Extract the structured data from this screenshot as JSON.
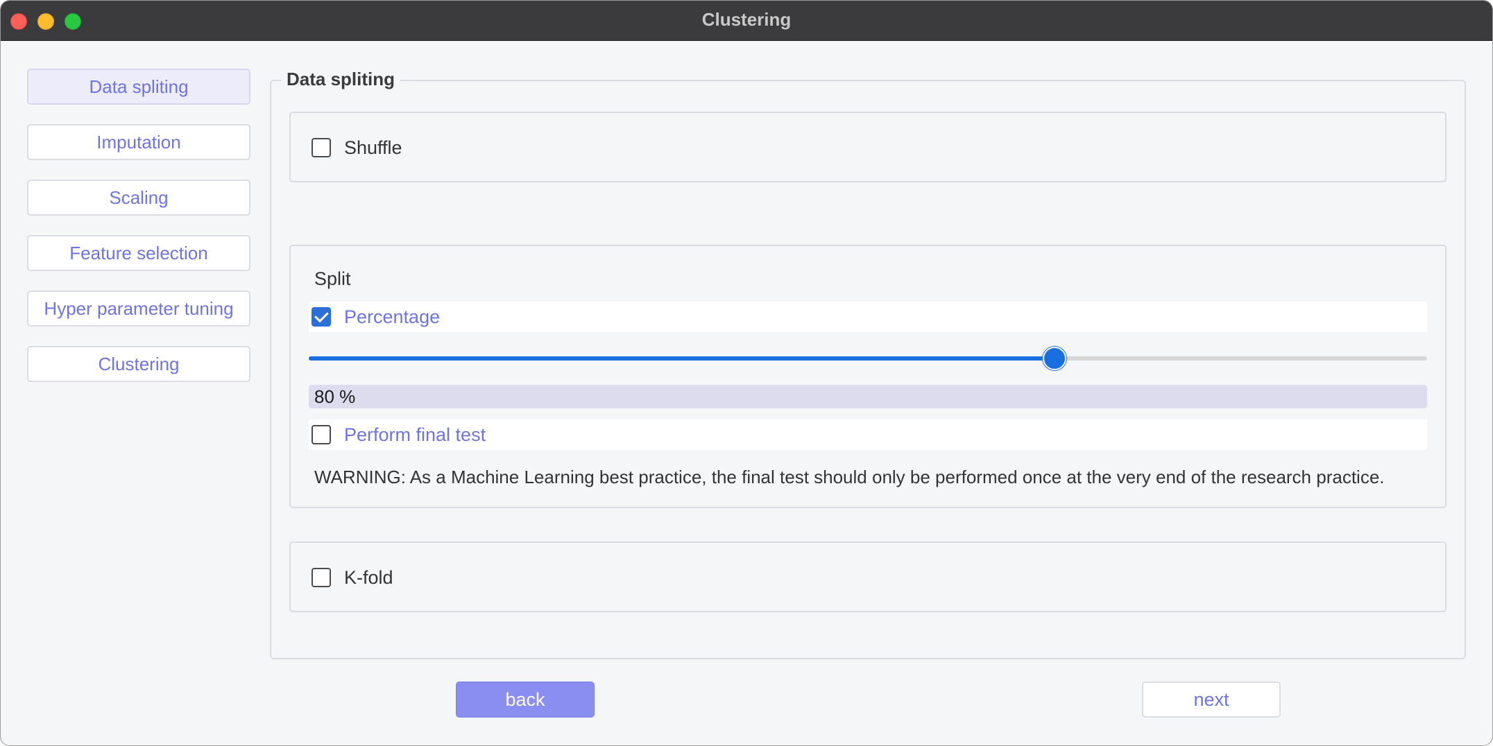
{
  "window": {
    "title": "Clustering"
  },
  "sidebar": {
    "items": [
      {
        "label": "Data spliting",
        "active": true
      },
      {
        "label": "Imputation"
      },
      {
        "label": "Scaling"
      },
      {
        "label": "Feature selection"
      },
      {
        "label": "Hyper parameter tuning"
      },
      {
        "label": "Clustering"
      }
    ]
  },
  "main": {
    "group_title": "Data spliting",
    "shuffle": {
      "label": "Shuffle",
      "checked": false
    },
    "split": {
      "heading": "Split",
      "percentage": {
        "label": "Percentage",
        "checked": true
      },
      "slider_value_percent": 80,
      "value_text": "80 %",
      "final_test": {
        "label": "Perform final test",
        "checked": false
      },
      "warning": "WARNING: As a Machine Learning best practice, the final test should only be performed once at the very end of the research practice."
    },
    "kfold": {
      "label": "K-fold",
      "checked": false
    }
  },
  "footer": {
    "back_label": "back",
    "next_label": "next"
  },
  "colors": {
    "accent": "#6f74e0",
    "slider": "#1a6fe0",
    "back_button": "#8a8ef0"
  }
}
